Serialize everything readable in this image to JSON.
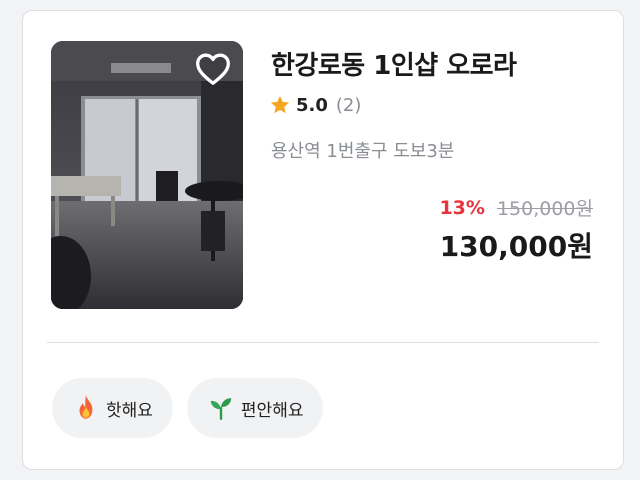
{
  "listing": {
    "title": "한강로동 1인샵 오로라",
    "rating": "5.0",
    "review_count": "(2)",
    "location": "용산역 1번출구 도보3분",
    "discount": "13%",
    "original_price": "150,000원",
    "price": "130,000원",
    "favorite_icon": "heart-outline-icon",
    "star_color": "#f5a623",
    "discount_color": "#e8343e"
  },
  "tags": [
    {
      "label": "핫해요",
      "icon": "fire-icon"
    },
    {
      "label": "편안해요",
      "icon": "sprout-icon"
    }
  ]
}
